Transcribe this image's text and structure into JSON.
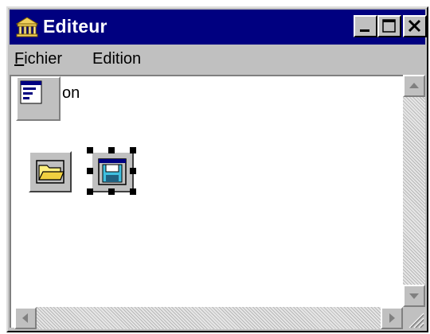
{
  "window": {
    "title": "Editeur",
    "app_icon": "classical-building-icon",
    "controls": [
      "minimize-icon",
      "maximize-icon",
      "close-icon"
    ]
  },
  "menu": [
    {
      "label": "Fichier",
      "mnemonic": "F",
      "rest": "ichier"
    },
    {
      "label": "Edition"
    }
  ],
  "content": {
    "partial_label": "on",
    "objects": [
      {
        "name": "open-folder",
        "icon": "folder-icon",
        "selected": false
      },
      {
        "name": "save",
        "icon": "floppy-disk-icon",
        "selected": true
      }
    ],
    "palette_icon": "form-icon"
  },
  "scrollbars": {
    "vertical": [
      "up-arrow-icon",
      "down-arrow-icon"
    ],
    "horizontal": [
      "left-arrow-icon",
      "right-arrow-icon"
    ]
  },
  "colors": {
    "titlebar": "#000080",
    "face": "#c0c0c0",
    "selection_handle": "#000000"
  }
}
